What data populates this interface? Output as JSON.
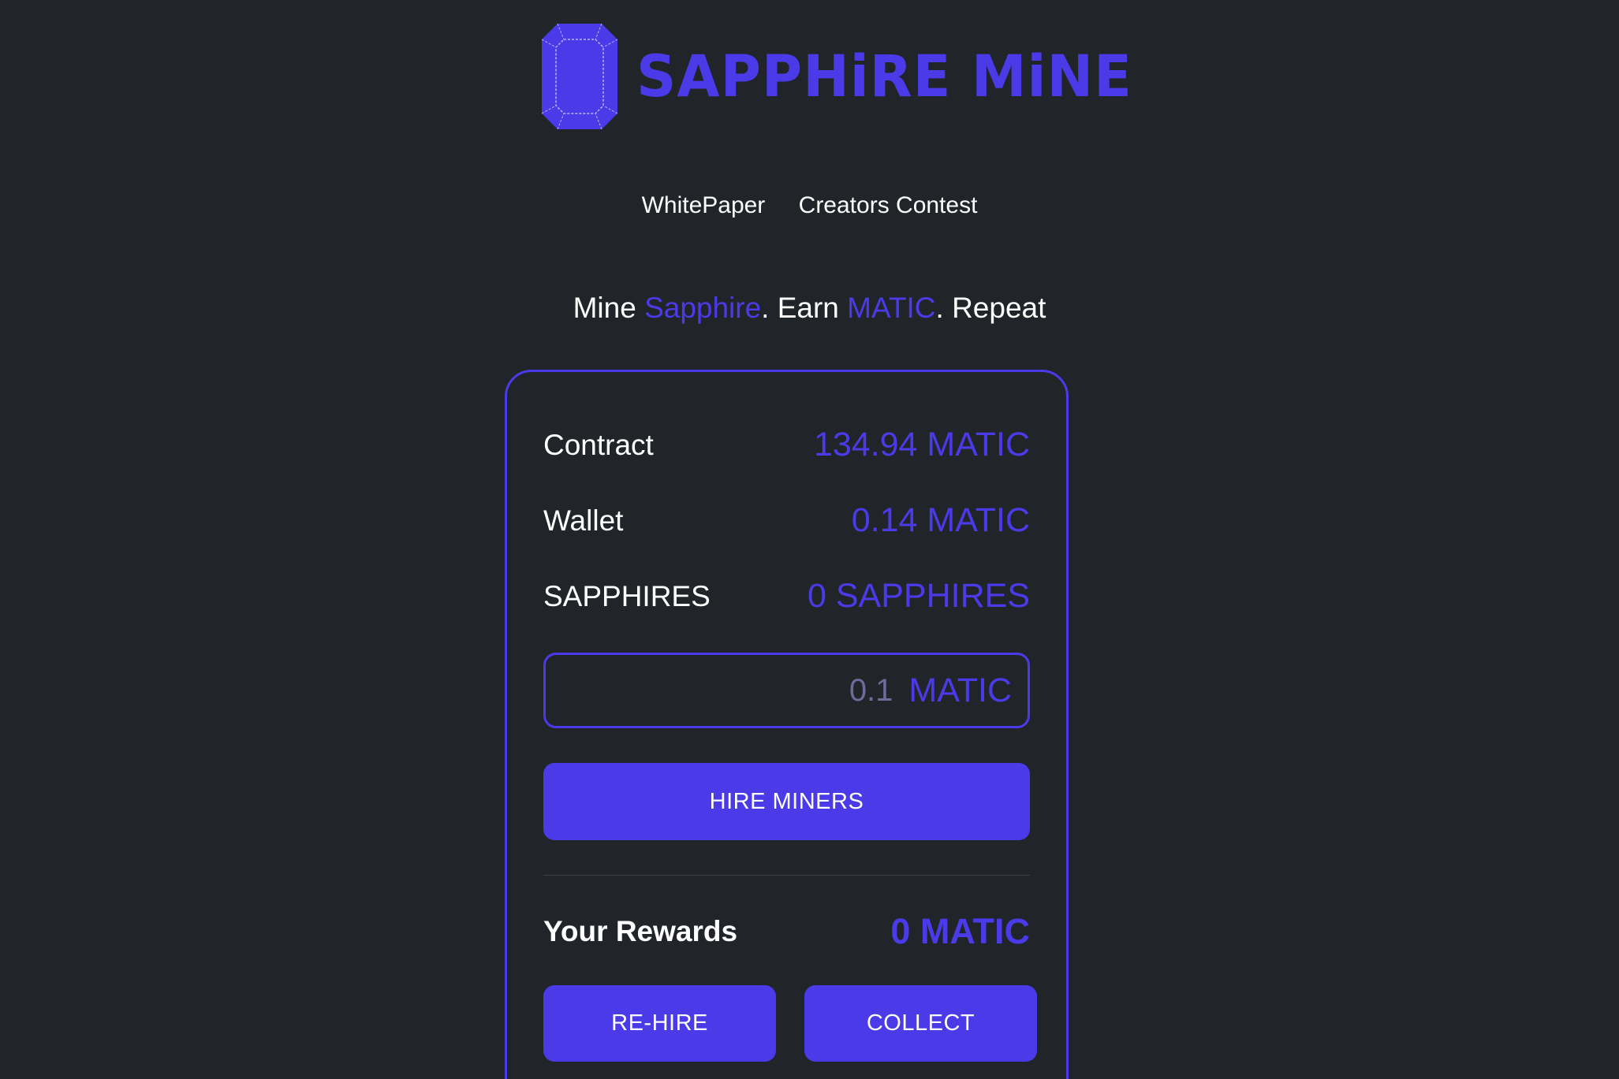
{
  "brand": {
    "name": "SAPPHiRE MiNE",
    "logo_icon": "sapphire-gem-icon",
    "accent_color": "#4a3ae8",
    "background_color": "#212529"
  },
  "nav": {
    "whitepaper": "WhitePaper",
    "creators_contest": "Creators Contest"
  },
  "tagline": {
    "part1": "Mine ",
    "accent1": "Sapphire",
    "part2": ". Earn ",
    "accent2": "MATIC",
    "part3": ". Repeat"
  },
  "stats": {
    "contract_label": "Contract",
    "contract_value": "134.94 MATIC",
    "wallet_label": "Wallet",
    "wallet_value": "0.14 MATIC",
    "sapphires_label": "SAPPHIRES",
    "sapphires_value": "0 SAPPHIRES"
  },
  "hire": {
    "amount_placeholder": "0.1",
    "amount_unit": "MATIC",
    "button_label": "HIRE MINERS"
  },
  "rewards": {
    "label": "Your Rewards",
    "value": "0 MATIC",
    "rehire_label": "RE-HIRE",
    "collect_label": "COLLECT"
  }
}
